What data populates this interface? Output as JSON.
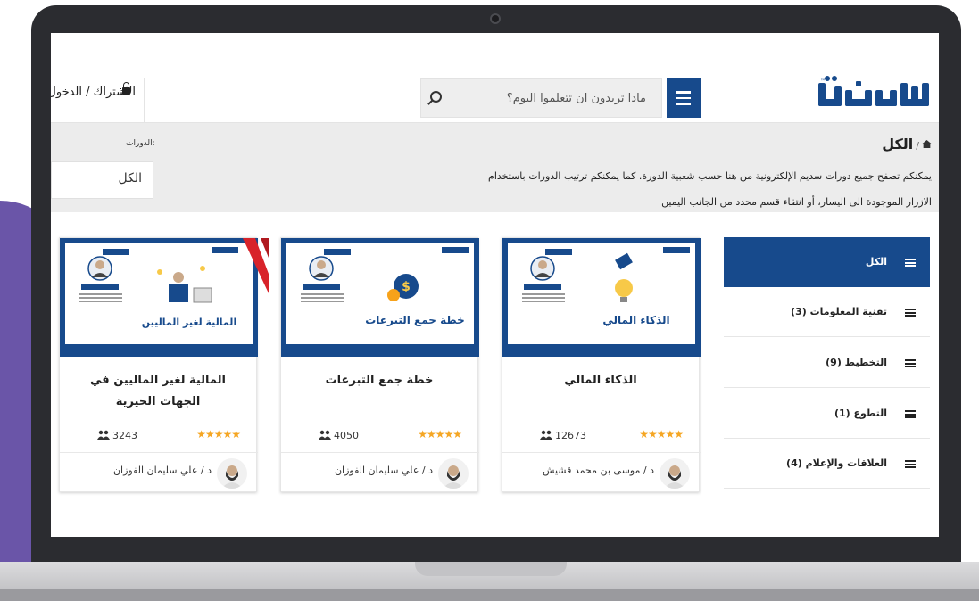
{
  "header": {
    "login_text": "الاشتراك / الدخول",
    "search_placeholder": "ماذا تريدون ان تتعلموا اليوم؟",
    "logo_text": "سديم",
    "brand_color": "#174a8c"
  },
  "breadcrumb": {
    "title": "الكل",
    "separator": "/",
    "description": "يمكنكم تصفح جميع دورات سديم الإلكترونية من هنا حسب شعبية الدورة. كما يمكنكم ترتيب الدورات باستخدام الازرار الموجودة الى اليسار، أو انتقاء قسم محدد من الجانب اليمين"
  },
  "filter": {
    "label": "الدورات:",
    "value": "الكل"
  },
  "sidebar": {
    "items": [
      {
        "label": "الكل",
        "active": true
      },
      {
        "label": "تقنية المعلومات (3)",
        "active": false
      },
      {
        "label": "التخطيط (9)",
        "active": false
      },
      {
        "label": "التطوع (1)",
        "active": false
      },
      {
        "label": "العلاقات والإعلام (4)",
        "active": false
      }
    ]
  },
  "courses": [
    {
      "title": "الذكاء المالي",
      "students": "12673",
      "rating": 5,
      "author": "د / موسى بن محمد قشيش",
      "thumb_text": "الذكاء المالي",
      "featured": false
    },
    {
      "title": "خطة جمع التبرعات",
      "students": "4050",
      "rating": 5,
      "author": "د / علي سليمان الفوزان",
      "thumb_text": "خطة جمع التبرعات",
      "featured": false
    },
    {
      "title": "المالية لغير الماليين في الجهات الخيرية",
      "students": "3243",
      "rating": 5,
      "author": "د / علي سليمان الفوزان",
      "thumb_text": "المالية لغير الماليين",
      "featured": true
    }
  ],
  "stars_text": "★★★★★",
  "colors": {
    "accent": "#174a8c",
    "star": "#f5a623",
    "ribbon": "#d8232a",
    "background_blob": "#6a55a8"
  }
}
